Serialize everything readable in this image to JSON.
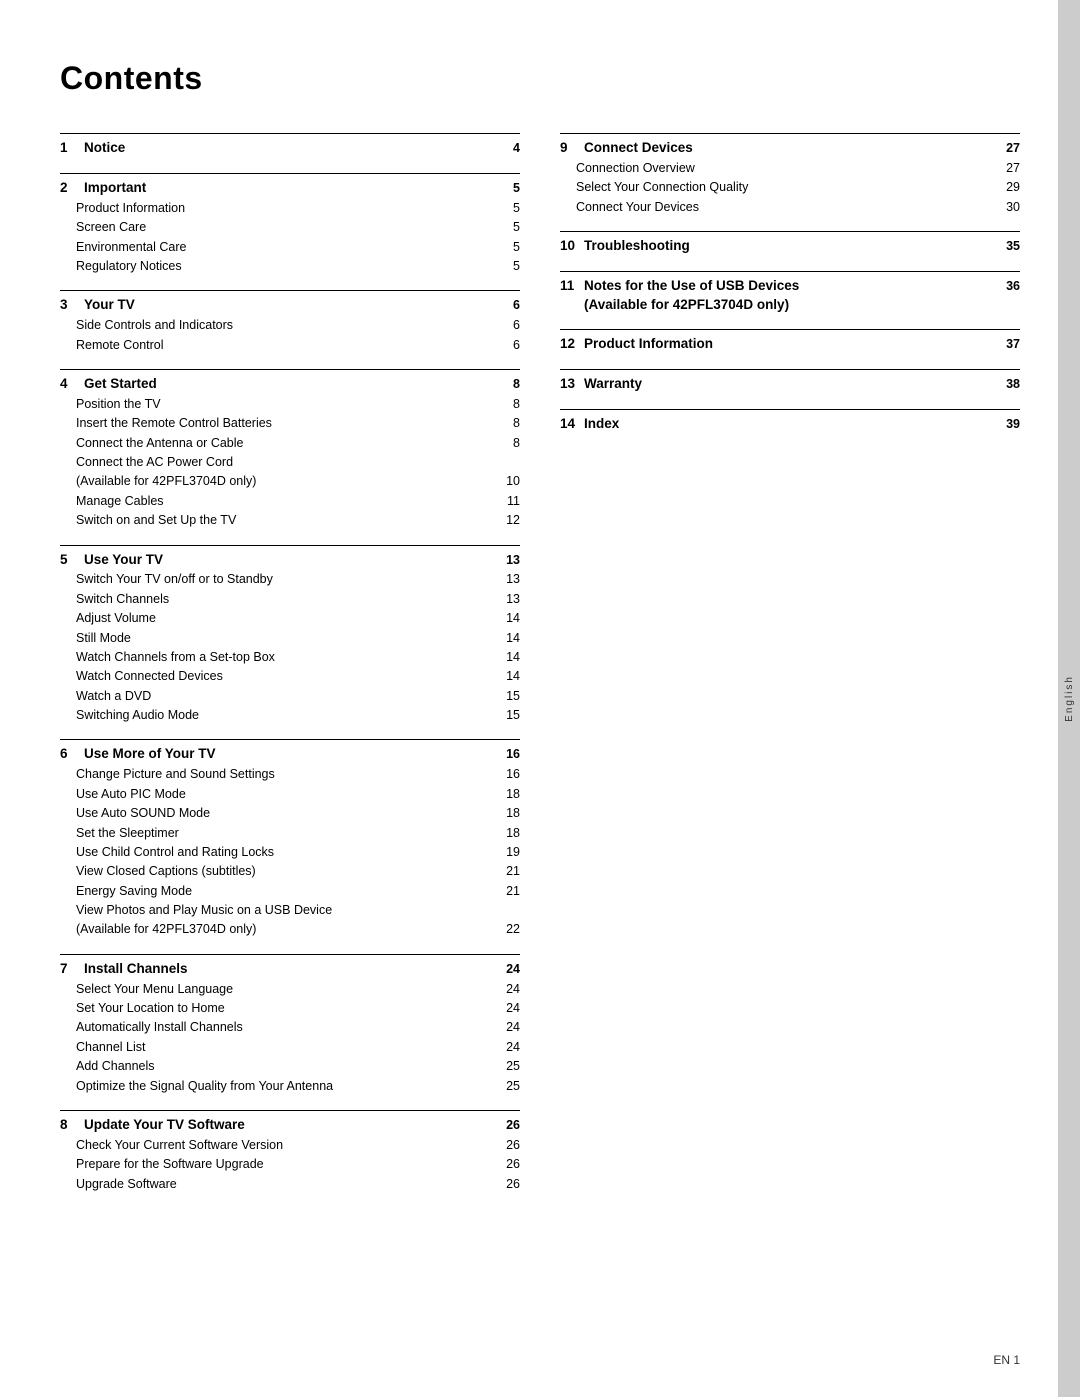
{
  "title": "Contents",
  "side_tab": "English",
  "footer": "EN   1",
  "left_col": [
    {
      "section_num": "1",
      "section_title": "Notice",
      "section_page": "4",
      "sub_items": []
    },
    {
      "section_num": "2",
      "section_title": "Important",
      "section_page": "5",
      "sub_items": [
        {
          "label": "Product Information",
          "page": "5"
        },
        {
          "label": "Screen Care",
          "page": "5"
        },
        {
          "label": "Environmental Care",
          "page": "5"
        },
        {
          "label": "Regulatory Notices",
          "page": "5"
        }
      ]
    },
    {
      "section_num": "3",
      "section_title": "Your TV",
      "section_page": "6",
      "sub_items": [
        {
          "label": "Side Controls and Indicators",
          "page": "6"
        },
        {
          "label": "Remote Control",
          "page": "6"
        }
      ]
    },
    {
      "section_num": "4",
      "section_title": "Get Started",
      "section_page": "8",
      "sub_items": [
        {
          "label": "Position the TV",
          "page": "8"
        },
        {
          "label": "Insert the Remote Control Batteries",
          "page": "8"
        },
        {
          "label": "Connect the Antenna or Cable",
          "page": "8"
        },
        {
          "label": "Connect the AC Power Cord",
          "page": ""
        },
        {
          "label": "(Available for 42PFL3704D only)",
          "page": "10"
        },
        {
          "label": "Manage Cables",
          "page": "11"
        },
        {
          "label": "Switch on and Set Up the TV",
          "page": "12"
        }
      ]
    },
    {
      "section_num": "5",
      "section_title": "Use Your TV",
      "section_page": "13",
      "sub_items": [
        {
          "label": "Switch Your TV on/off or to Standby",
          "page": "13"
        },
        {
          "label": "Switch Channels",
          "page": "13"
        },
        {
          "label": "Adjust Volume",
          "page": "14"
        },
        {
          "label": "Still Mode",
          "page": "14"
        },
        {
          "label": "Watch Channels from a Set-top Box",
          "page": "14"
        },
        {
          "label": "Watch Connected Devices",
          "page": "14"
        },
        {
          "label": "Watch a DVD",
          "page": "15"
        },
        {
          "label": "Switching Audio Mode",
          "page": "15"
        }
      ]
    },
    {
      "section_num": "6",
      "section_title": "Use More of Your TV",
      "section_page": "16",
      "sub_items": [
        {
          "label": "Change Picture and Sound Settings",
          "page": "16"
        },
        {
          "label": "Use Auto PIC Mode",
          "page": "18"
        },
        {
          "label": "Use Auto SOUND Mode",
          "page": "18"
        },
        {
          "label": "Set the Sleeptimer",
          "page": "18"
        },
        {
          "label": "Use Child Control and Rating Locks",
          "page": "19"
        },
        {
          "label": "View Closed Captions (subtitles)",
          "page": "21"
        },
        {
          "label": "Energy Saving Mode",
          "page": "21"
        },
        {
          "label": "View Photos and Play Music on a USB Device",
          "page": ""
        },
        {
          "label": "(Available for 42PFL3704D only)",
          "page": "22"
        }
      ]
    },
    {
      "section_num": "7",
      "section_title": "Install Channels",
      "section_page": "24",
      "sub_items": [
        {
          "label": "Select Your Menu Language",
          "page": "24"
        },
        {
          "label": "Set Your Location to Home",
          "page": "24"
        },
        {
          "label": "Automatically Install Channels",
          "page": "24"
        },
        {
          "label": "Channel List",
          "page": "24"
        },
        {
          "label": "Add Channels",
          "page": "25"
        },
        {
          "label": "Optimize the Signal Quality from Your Antenna",
          "page": "25"
        }
      ]
    },
    {
      "section_num": "8",
      "section_title": "Update Your TV Software",
      "section_page": "26",
      "sub_items": [
        {
          "label": "Check Your Current Software Version",
          "page": "26"
        },
        {
          "label": "Prepare for the Software Upgrade",
          "page": "26"
        },
        {
          "label": "Upgrade Software",
          "page": "26"
        }
      ]
    }
  ],
  "right_col": [
    {
      "section_num": "9",
      "section_title": "Connect Devices",
      "section_page": "27",
      "sub_items": [
        {
          "label": "Connection Overview",
          "page": "27"
        },
        {
          "label": "Select Your Connection Quality",
          "page": "29"
        },
        {
          "label": "Connect Your Devices",
          "page": "30"
        }
      ]
    },
    {
      "section_num": "10",
      "section_title": "Troubleshooting",
      "section_page": "35",
      "sub_items": []
    },
    {
      "section_num": "11",
      "section_title": "Notes for the Use of USB Devices\n(Available for 42PFL3704D only)",
      "section_page": "36",
      "sub_items": [],
      "multiline": true
    },
    {
      "section_num": "12",
      "section_title": "Product Information",
      "section_page": "37",
      "sub_items": []
    },
    {
      "section_num": "13",
      "section_title": "Warranty",
      "section_page": "38",
      "sub_items": []
    },
    {
      "section_num": "14",
      "section_title": "Index",
      "section_page": "39",
      "sub_items": []
    }
  ]
}
